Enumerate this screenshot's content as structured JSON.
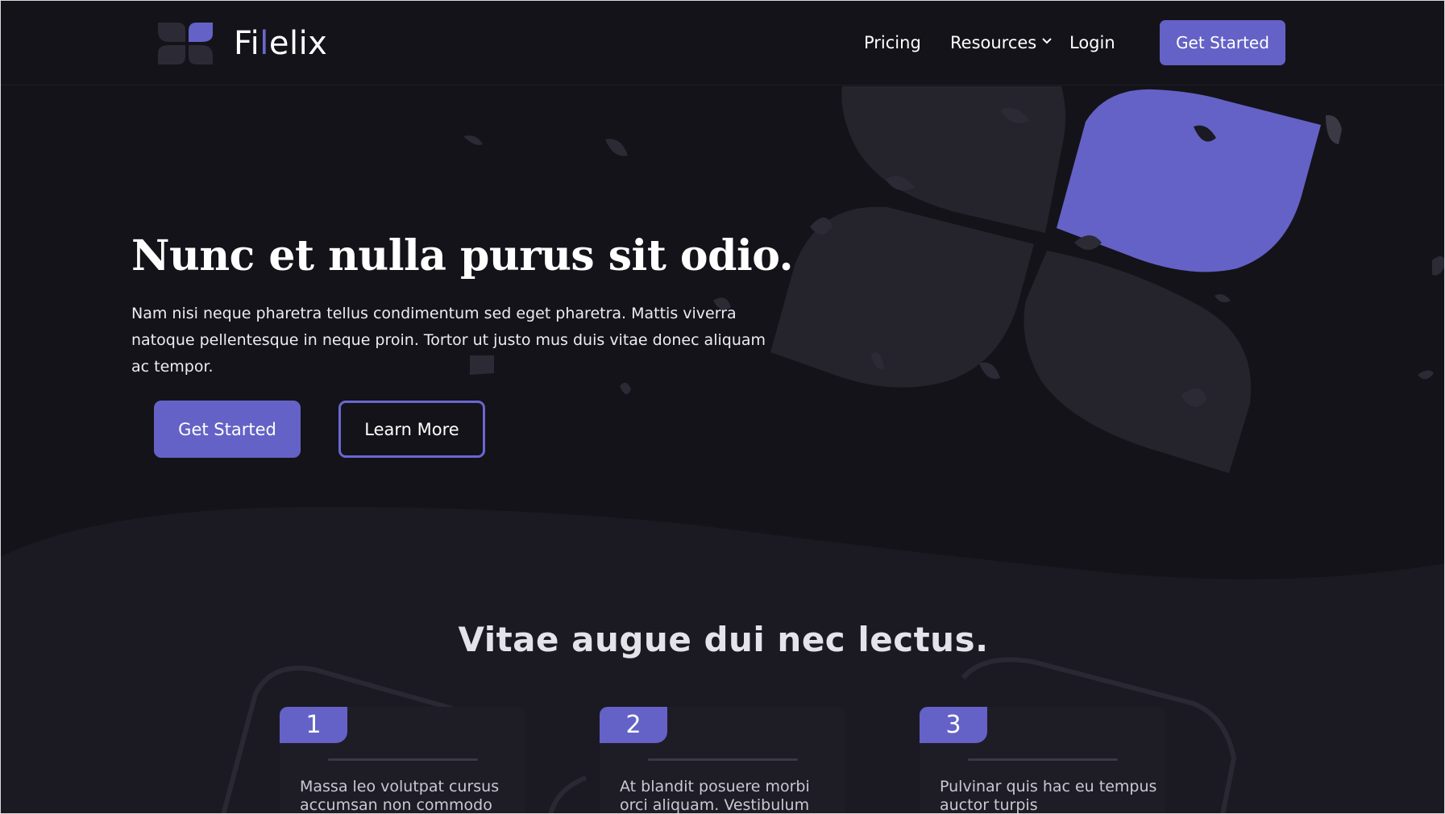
{
  "brand": {
    "name_part1": "Fi",
    "name_accent": "l",
    "name_part2": "elix"
  },
  "nav": {
    "links": [
      {
        "label": "Pricing"
      },
      {
        "label": "Resources",
        "has_dropdown": true
      },
      {
        "label": "Login"
      }
    ],
    "cta_label": "Get Started"
  },
  "hero": {
    "title": "Nunc et nulla purus sit odio.",
    "subtitle": "Nam nisi neque pharetra tellus condimentum sed eget pharetra. Mattis viverra natoque pellentesque in neque proin. Tortor ut justo mus duis vitae donec aliquam ac tempor.",
    "primary_button": "Get Started",
    "secondary_button": "Learn More"
  },
  "features": {
    "title": "Vitae augue dui nec lectus.",
    "cards": [
      {
        "number": "1",
        "text": "Massa leo volutpat cursus accumsan non commodo"
      },
      {
        "number": "2",
        "text": "At blandit posuere morbi orci aliquam. Vestibulum"
      },
      {
        "number": "3",
        "text": "Pulvinar quis hac eu tempus auctor turpis"
      }
    ]
  },
  "colors": {
    "background": "#141319",
    "accent": "#6462c6",
    "surface": "#1e1d26",
    "petal_dark": "#25242d"
  },
  "icons": [
    "logo-mark-icon",
    "chevron-down-icon",
    "flower-illustration"
  ]
}
